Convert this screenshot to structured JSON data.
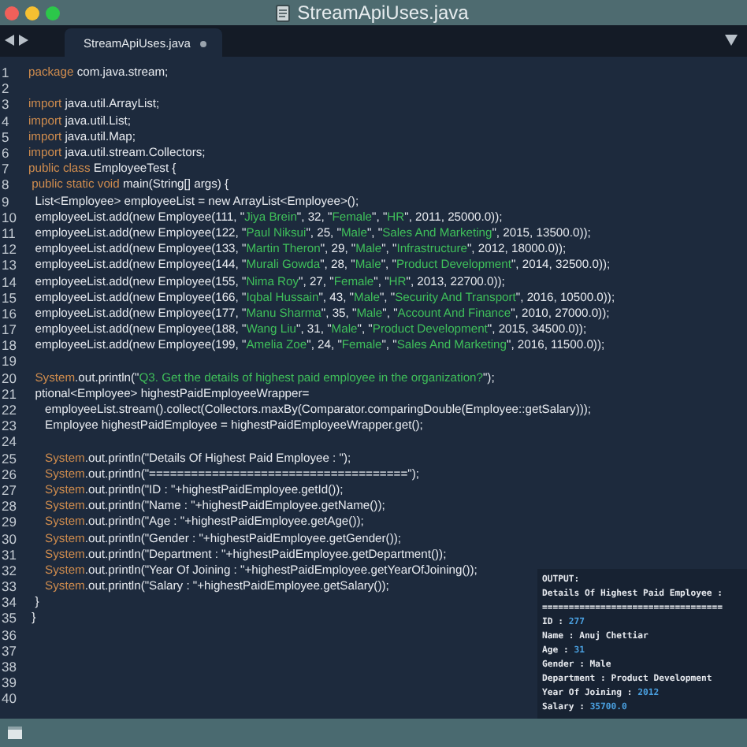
{
  "window": {
    "title": "StreamApiUses.java"
  },
  "tabs": [
    {
      "label": "StreamApiUses.java",
      "selected": true,
      "modified": true
    }
  ],
  "editor": {
    "lines": [
      {
        "number": "1",
        "tokens": [
          {
            "kind": "keyword",
            "text": "package"
          },
          {
            "kind": "plain",
            "text": " com.java.stream;"
          }
        ]
      },
      {
        "number": "2"
      },
      {
        "number": "3",
        "tokens": [
          {
            "kind": "keyword",
            "text": "import"
          },
          {
            "kind": "plain",
            "text": " java.util.ArrayList;"
          }
        ]
      },
      {
        "number": "4",
        "tokens": [
          {
            "kind": "keyword",
            "text": "import"
          },
          {
            "kind": "plain",
            "text": " java.util.List;"
          }
        ]
      },
      {
        "number": "5",
        "tokens": [
          {
            "kind": "keyword",
            "text": "import"
          },
          {
            "kind": "plain",
            "text": " java.util.Map;"
          }
        ]
      },
      {
        "number": "6",
        "tokens": [
          {
            "kind": "keyword",
            "text": "import"
          },
          {
            "kind": "plain",
            "text": " java.util.stream.Collectors;"
          }
        ]
      },
      {
        "number": "7",
        "tokens": [
          {
            "kind": "keyword",
            "text": "public class"
          },
          {
            "kind": "plain",
            "text": " EmployeeTest {"
          }
        ]
      },
      {
        "number": "8",
        "tokens": [
          {
            "kind": "keyword",
            "text": " public static void"
          },
          {
            "kind": "plain",
            "text": " main(String[] args) {"
          }
        ]
      },
      {
        "number": "9",
        "tokens": [
          {
            "kind": "plain",
            "text": "  List<Employee> employeeList = new ArrayList<Employee>();"
          }
        ]
      },
      {
        "number": "10",
        "tokens": [
          {
            "kind": "plain",
            "text": "  employeeList.add(new Employee(111, \""
          },
          {
            "kind": "string",
            "text": "Jiya Brein"
          },
          {
            "kind": "plain",
            "text": "\", 32, \""
          },
          {
            "kind": "string",
            "text": "Female"
          },
          {
            "kind": "plain",
            "text": "\", \""
          },
          {
            "kind": "string",
            "text": "HR"
          },
          {
            "kind": "plain",
            "text": "\", 2011, 25000.0));"
          }
        ]
      },
      {
        "number": "11",
        "tokens": [
          {
            "kind": "plain",
            "text": "  employeeList.add(new Employee(122, \""
          },
          {
            "kind": "string",
            "text": "Paul Niksui"
          },
          {
            "kind": "plain",
            "text": "\", 25, \""
          },
          {
            "kind": "string",
            "text": "Male"
          },
          {
            "kind": "plain",
            "text": "\", \""
          },
          {
            "kind": "string",
            "text": "Sales And Marketing"
          },
          {
            "kind": "plain",
            "text": "\", 2015, 13500.0));"
          }
        ]
      },
      {
        "number": "12",
        "tokens": [
          {
            "kind": "plain",
            "text": "  employeeList.add(new Employee(133, \""
          },
          {
            "kind": "string",
            "text": "Martin Theron"
          },
          {
            "kind": "plain",
            "text": "\", 29, \""
          },
          {
            "kind": "string",
            "text": "Male"
          },
          {
            "kind": "plain",
            "text": "\", \""
          },
          {
            "kind": "string",
            "text": "Infrastructure"
          },
          {
            "kind": "plain",
            "text": "\", 2012, 18000.0));"
          }
        ]
      },
      {
        "number": "13",
        "tokens": [
          {
            "kind": "plain",
            "text": "  employeeList.add(new Employee(144, \""
          },
          {
            "kind": "string",
            "text": "Murali Gowda"
          },
          {
            "kind": "plain",
            "text": "\", 28, \""
          },
          {
            "kind": "string",
            "text": "Male"
          },
          {
            "kind": "plain",
            "text": "\", \""
          },
          {
            "kind": "string",
            "text": "Product Development"
          },
          {
            "kind": "plain",
            "text": "\", 2014, 32500.0));"
          }
        ]
      },
      {
        "number": "14",
        "tokens": [
          {
            "kind": "plain",
            "text": "  employeeList.add(new Employee(155, \""
          },
          {
            "kind": "string",
            "text": "Nima Roy"
          },
          {
            "kind": "plain",
            "text": "\", 27, \""
          },
          {
            "kind": "string",
            "text": "Female"
          },
          {
            "kind": "plain",
            "text": "\", \""
          },
          {
            "kind": "string",
            "text": "HR"
          },
          {
            "kind": "plain",
            "text": "\", 2013, 22700.0));"
          }
        ]
      },
      {
        "number": "15",
        "tokens": [
          {
            "kind": "plain",
            "text": "  employeeList.add(new Employee(166, \""
          },
          {
            "kind": "string",
            "text": "Iqbal Hussain"
          },
          {
            "kind": "plain",
            "text": "\", 43, \""
          },
          {
            "kind": "string",
            "text": "Male"
          },
          {
            "kind": "plain",
            "text": "\", \""
          },
          {
            "kind": "string",
            "text": "Security And Transport"
          },
          {
            "kind": "plain",
            "text": "\", 2016, 10500.0));"
          }
        ]
      },
      {
        "number": "16",
        "tokens": [
          {
            "kind": "plain",
            "text": "  employeeList.add(new Employee(177, \""
          },
          {
            "kind": "string",
            "text": "Manu Sharma"
          },
          {
            "kind": "plain",
            "text": "\", 35, \""
          },
          {
            "kind": "string",
            "text": "Male"
          },
          {
            "kind": "plain",
            "text": "\", \""
          },
          {
            "kind": "string",
            "text": "Account And Finance"
          },
          {
            "kind": "plain",
            "text": "\", 2010, 27000.0));"
          }
        ]
      },
      {
        "number": "17",
        "tokens": [
          {
            "kind": "plain",
            "text": "  employeeList.add(new Employee(188, \""
          },
          {
            "kind": "string",
            "text": "Wang Liu"
          },
          {
            "kind": "plain",
            "text": "\", 31, \""
          },
          {
            "kind": "string",
            "text": "Male"
          },
          {
            "kind": "plain",
            "text": "\", \""
          },
          {
            "kind": "string",
            "text": "Product Development"
          },
          {
            "kind": "plain",
            "text": "\", 2015, 34500.0));"
          }
        ]
      },
      {
        "number": "18",
        "tokens": [
          {
            "kind": "plain",
            "text": "  employeeList.add(new Employee(199, \""
          },
          {
            "kind": "string",
            "text": "Amelia Zoe"
          },
          {
            "kind": "plain",
            "text": "\", 24, \""
          },
          {
            "kind": "string",
            "text": "Female"
          },
          {
            "kind": "plain",
            "text": "\", \""
          },
          {
            "kind": "string",
            "text": "Sales And Marketing"
          },
          {
            "kind": "plain",
            "text": "\", 2016, 11500.0));"
          }
        ]
      },
      {
        "number": "19"
      },
      {
        "number": "20",
        "tokens": [
          {
            "kind": "keyword",
            "text": "  System"
          },
          {
            "kind": "plain",
            "text": ".out.println(\""
          },
          {
            "kind": "string",
            "text": "Q3. Get the details of highest paid employee in the organization?"
          },
          {
            "kind": "plain",
            "text": "\");"
          }
        ]
      },
      {
        "number": "21",
        "tokens": [
          {
            "kind": "plain",
            "text": "  ptional<Employee> highestPaidEmployeeWrapper="
          }
        ]
      },
      {
        "number": "22",
        "tokens": [
          {
            "kind": "plain",
            "text": "     employeeList.stream().collect(Collectors.maxBy(Comparator.comparingDouble(Employee::getSalary)));"
          }
        ]
      },
      {
        "number": "23",
        "tokens": [
          {
            "kind": "plain",
            "text": "     Employee highestPaidEmployee = highestPaidEmployeeWrapper.get();"
          }
        ]
      },
      {
        "number": "24"
      },
      {
        "number": "25",
        "tokens": [
          {
            "kind": "keyword",
            "text": "     System"
          },
          {
            "kind": "plain",
            "text": ".out.println(\"Details Of Highest Paid Employee : \");"
          }
        ]
      },
      {
        "number": "26",
        "tokens": [
          {
            "kind": "keyword",
            "text": "     System"
          },
          {
            "kind": "plain",
            "text": ".out.println(\"=====================================\");"
          }
        ]
      },
      {
        "number": "27",
        "tokens": [
          {
            "kind": "keyword",
            "text": "     System"
          },
          {
            "kind": "plain",
            "text": ".out.println(\"ID : \"+highestPaidEmployee.getId());"
          }
        ]
      },
      {
        "number": "28",
        "tokens": [
          {
            "kind": "keyword",
            "text": "     System"
          },
          {
            "kind": "plain",
            "text": ".out.println(\"Name : \"+highestPaidEmployee.getName());"
          }
        ]
      },
      {
        "number": "29",
        "tokens": [
          {
            "kind": "keyword",
            "text": "     System"
          },
          {
            "kind": "plain",
            "text": ".out.println(\"Age : \"+highestPaidEmployee.getAge());"
          }
        ]
      },
      {
        "number": "30",
        "tokens": [
          {
            "kind": "keyword",
            "text": "     System"
          },
          {
            "kind": "plain",
            "text": ".out.println(\"Gender : \"+highestPaidEmployee.getGender());"
          }
        ]
      },
      {
        "number": "31",
        "tokens": [
          {
            "kind": "keyword",
            "text": "     System"
          },
          {
            "kind": "plain",
            "text": ".out.println(\"Department : \"+highestPaidEmployee.getDepartment());"
          }
        ]
      },
      {
        "number": "32",
        "tokens": [
          {
            "kind": "keyword",
            "text": "     System"
          },
          {
            "kind": "plain",
            "text": ".out.println(\"Year Of Joining : \"+highestPaidEmployee.getYearOfJoining());"
          }
        ]
      },
      {
        "number": "33",
        "tokens": [
          {
            "kind": "keyword",
            "text": "     System"
          },
          {
            "kind": "plain",
            "text": ".out.println(\"Salary : \"+highestPaidEmployee.getSalary());"
          }
        ]
      },
      {
        "number": "34",
        "tokens": [
          {
            "kind": "plain",
            "text": "  }"
          }
        ]
      },
      {
        "number": "35",
        "tokens": [
          {
            "kind": "plain",
            "text": " }"
          }
        ]
      },
      {
        "number": "36"
      },
      {
        "number": "37"
      },
      {
        "number": "38"
      },
      {
        "number": "39"
      },
      {
        "number": "40"
      }
    ]
  },
  "output": {
    "title": "OUTPUT:",
    "lines": [
      [
        {
          "kind": "label",
          "text": "Details Of Highest Paid Employee :"
        }
      ],
      [
        {
          "kind": "label",
          "text": "=================================="
        }
      ],
      [
        {
          "kind": "label",
          "text": "ID : "
        },
        {
          "kind": "number",
          "text": "277"
        }
      ],
      [
        {
          "kind": "label",
          "text": "Name : Anuj Chettiar"
        }
      ],
      [
        {
          "kind": "label",
          "text": "Age : "
        },
        {
          "kind": "number",
          "text": "31"
        }
      ],
      [
        {
          "kind": "label",
          "text": "Gender : Male"
        }
      ],
      [
        {
          "kind": "label",
          "text": "Department : Product Development"
        }
      ],
      [
        {
          "kind": "label",
          "text": "Year Of Joining : "
        },
        {
          "kind": "number",
          "text": "2012"
        }
      ],
      [
        {
          "kind": "label",
          "text": "Salary : "
        },
        {
          "kind": "number",
          "text": "35700.0"
        }
      ]
    ]
  }
}
